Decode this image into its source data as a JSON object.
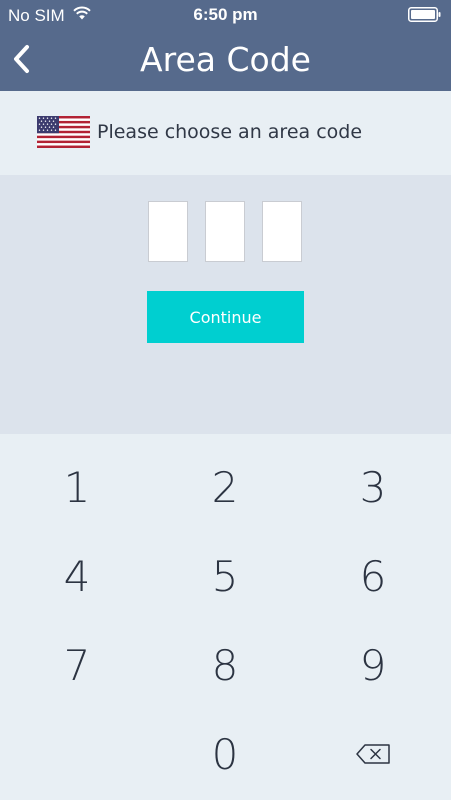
{
  "status_bar": {
    "carrier": "No SIM",
    "time": "6:50 pm",
    "wifi_icon": "wifi-icon",
    "battery_icon": "battery-icon"
  },
  "nav": {
    "back_icon": "chevron-left-icon",
    "title": "Area Code"
  },
  "prompt": {
    "flag_icon": "us-flag-icon",
    "text": "Please choose an area code"
  },
  "entry": {
    "digits": [
      "",
      "",
      ""
    ],
    "continue_label": "Continue"
  },
  "keypad": {
    "keys": [
      "1",
      "2",
      "3",
      "4",
      "5",
      "6",
      "7",
      "8",
      "9",
      "0"
    ],
    "delete_icon": "backspace-icon"
  },
  "colors": {
    "header": "#566a8c",
    "accent": "#00cfd0",
    "background": "#e8eff4",
    "entry_background": "#dce3ec",
    "text": "#2c3442"
  }
}
